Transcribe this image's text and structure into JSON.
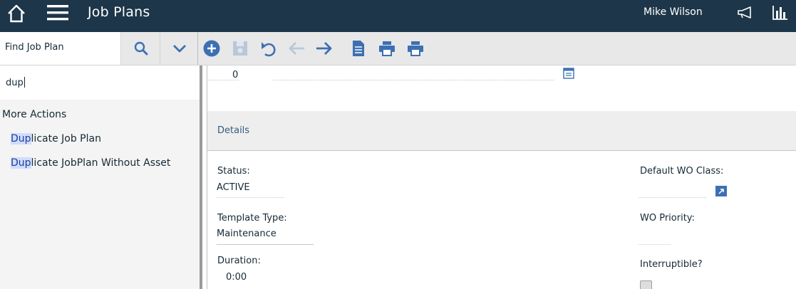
{
  "header": {
    "title": "Job Plans",
    "user": "Mike Wilson",
    "icons": [
      "home-icon",
      "menu-icon",
      "bullhorn-icon",
      "bar-chart-icon"
    ]
  },
  "toolbar": {
    "find_label": "Find Job Plan",
    "icons": [
      "search-icon",
      "chevron-down-icon",
      "new-record-icon",
      "save-icon",
      "undo-icon",
      "previous-icon",
      "next-icon",
      "document-icon",
      "print-icon",
      "print-icon"
    ]
  },
  "filter": {
    "value": "dup"
  },
  "actions": {
    "heading": "More Actions",
    "items": [
      {
        "match": "Dup",
        "rest": "licate Job Plan"
      },
      {
        "match": "Dup",
        "rest": "licate JobPlan Without Asset"
      }
    ]
  },
  "main": {
    "top_value": "0",
    "section_title": "Details",
    "fields": {
      "status_label": "Status:",
      "status_value": "ACTIVE",
      "template_type_label": "Template Type:",
      "template_type_value": "Maintenance",
      "duration_label": "Duration:",
      "duration_value": "0:00",
      "default_wo_class_label": "Default WO Class:",
      "wo_priority_label": "WO Priority:",
      "interruptible_label": "Interruptible?"
    }
  },
  "colors": {
    "header_bg": "#1d3649",
    "accent": "#3d70b2",
    "highlight": "#d0dcff"
  }
}
